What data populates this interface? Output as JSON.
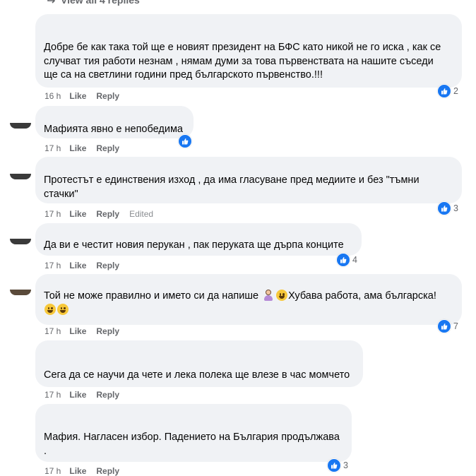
{
  "view_replies": {
    "label": "View all 4 replies"
  },
  "actions": {
    "like": "Like",
    "reply": "Reply",
    "edited": "Edited"
  },
  "comments": [
    {
      "text_lines": [
        "Добре бе как така той ще е новият президент на БФС като никой не го иска , как се",
        "случват тия работи незнам , нямам думи за това първенствата на нашите съседи",
        "ще са на светлини години пред българското първенство.!!!"
      ],
      "time": "16 h",
      "reactions": "2",
      "edited": false
    },
    {
      "text_lines": [
        "Мафията явно е непобедима"
      ],
      "time": "17 h",
      "reactions": "",
      "edited": false
    },
    {
      "text_lines": [
        "Протестът е единствения изход , да има гласуване пред медиите и без \"тъмни",
        "стачки\""
      ],
      "time": "17 h",
      "reactions": "3",
      "edited": true
    },
    {
      "text_lines": [
        "Да ви е честит новия перукан , пак перуката ще дърпа конците"
      ],
      "time": "17 h",
      "reactions": "4",
      "edited": false
    },
    {
      "text_part1": "Той не може правилно и името си да напише",
      "text_part2": "Хубава работа, ама българска!",
      "time": "17 h",
      "reactions": "7",
      "edited": false
    },
    {
      "text_lines": [
        "Сега да се научи да чете и лека полека ще влезе в час момчето"
      ],
      "time": "17 h",
      "reactions": "",
      "edited": false
    },
    {
      "text_lines": [
        "Мафия. Нагласен избор. Падението на България продължава",
        "."
      ],
      "time": "17 h",
      "reactions": "3",
      "edited": false
    }
  ]
}
